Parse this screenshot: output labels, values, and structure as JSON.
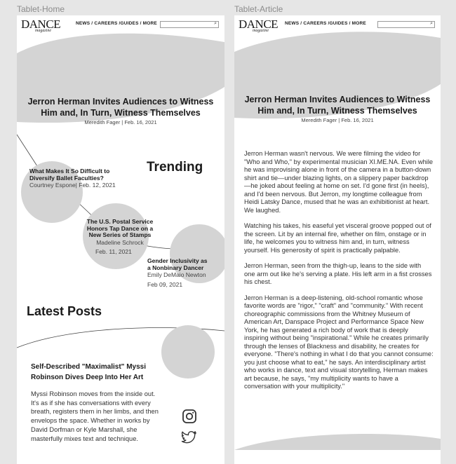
{
  "frames": [
    {
      "label": "Tablet-Home"
    },
    {
      "label": "Tablet-Article"
    }
  ],
  "header": {
    "logo_main": "DANCE",
    "logo_sub": "magazine",
    "nav": "NEWS / CAREERS /GUIDES / MORE",
    "search_placeholder": ""
  },
  "hero": {
    "title_line1": "Jerron Herman Invites Audiences to Witness",
    "title_line2": "Him and, In Turn, Witness Themselves",
    "meta": "Meredith Fager | Feb. 16, 2021"
  },
  "trending": {
    "heading": "Trending",
    "items": [
      {
        "title_line1": "What Makes It So Difficult to",
        "title_line2": "Diversify Ballet Faculties?",
        "meta": "Courtney Espone| Feb. 12, 2021"
      },
      {
        "title_line1": "The U.S. Postal Service",
        "title_line2": "Honors Tap Dance on a",
        "title_line3": "New Series of Stamps",
        "author": "Madeline Schrock",
        "date": "Feb. 11, 2021"
      },
      {
        "title_line1": "Gender Inclusivity as",
        "title_line2": "a Nonbinary Dancer",
        "author": "Emily DeMaio Newton",
        "date": "Feb 09, 2021"
      }
    ]
  },
  "latest": {
    "heading": "Latest Posts",
    "post_title_line1": "Self-Described \"Maximalist\" Myssi",
    "post_title_line2": "Robinson Dives Deep Into Her Art",
    "excerpt": "Myssi Robinson moves from the inside out. It's as if she has conversations with every breath, registers them in her limbs, and then envelops the space. Whether in works by David Dorfman or Kyle Marshall, she masterfully mixes text and technique."
  },
  "social": {
    "icons": [
      "instagram-icon",
      "twitter-icon"
    ]
  },
  "article": {
    "paragraphs": [
      "Jerron Herman wasn't nervous. We were filming the video for \"Who and Who,\" by experimental musician XI.ME.NA. Even while he was improvising alone in front of the camera in a button-down shirt and tie—under blazing lights, on a slippery paper backdrop—he joked about feeling at home on set. I'd gone first (in heels), and I'd been nervous. But Jerron, my longtime colleague from Heidi Latsky Dance, mused that he was an exhibitionist at heart. We laughed.",
      "Watching his takes, his easeful yet visceral groove popped out of the screen. Lit by an internal fire, whether on film, onstage or in life, he welcomes you to witness him and, in turn, witness yourself. His generosity of spirit is practically palpable.",
      "Jerron Herman, seen from the thigh-up, leans to the side with one arm out like he's serving a plate. His left arm in a fist crosses his chest.",
      "Jerron Herman is a deep-listening, old-school romantic whose favorite words are \"rigor,\" \"craft\" and \"community.\" With recent choreographic commissions from the Whitney Museum of American Art, Danspace Project and Performance Space New York, he has generated a rich body of work that is deeply inspiring without being \"inspirational.\" While he creates primarily through the lenses of Blackness and disability, he creates for everyone. \"There's nothing in what I do that you cannot consume: you just choose what to eat,\" he says. An interdisciplinary artist who works in dance, text and visual storytelling, Herman makes art because, he says, \"my multiplicity wants to have a conversation with your multiplicity.\""
    ]
  },
  "colors": {
    "background": "#e6e6e6",
    "placeholder_gray": "#d4d4d4",
    "frame": "#ffffff"
  }
}
